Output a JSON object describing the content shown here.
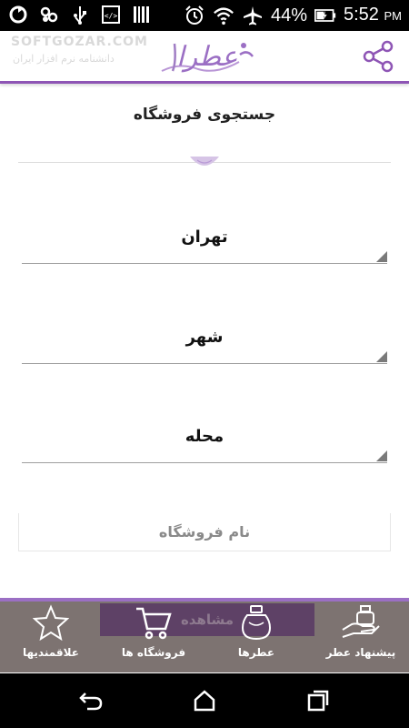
{
  "status_bar": {
    "battery_percent": "44%",
    "time": "5:52",
    "time_suffix": "PM"
  },
  "header": {
    "logo_text": "عطرا",
    "watermark": "SOFTGOZAR.COM",
    "watermark_sub": "دانشنامه نرم افزار ایران"
  },
  "page": {
    "title": "جستجوی فروشگاه"
  },
  "form": {
    "province": "تهران",
    "city": "شهر",
    "district": "محله",
    "store_name_placeholder": "نام فروشگاه"
  },
  "actions": {
    "view_label": "مشاهده"
  },
  "bottom_nav": {
    "favorites": "علاقمندیها",
    "stores": "فروشگاه ها",
    "perfumes": "عطرها",
    "suggest": "پیشنهاد عطر"
  },
  "colors": {
    "accent": "#8e55b5",
    "nav_bg": "#7d7371",
    "view_btn_bg": "#5e4166"
  }
}
